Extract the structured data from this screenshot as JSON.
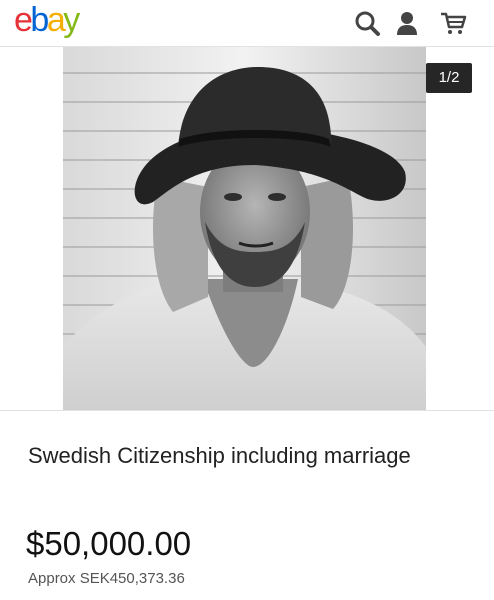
{
  "header": {
    "logo": {
      "letters": [
        "e",
        "b",
        "a",
        "y"
      ],
      "colors": [
        "#e53238",
        "#0064d2",
        "#f5af02",
        "#86b817"
      ]
    },
    "icons": [
      "search-icon",
      "user-icon",
      "cart-icon"
    ]
  },
  "gallery": {
    "counter": "1/2",
    "image": "black-and-white-portrait-man-with-wide-brim-hat"
  },
  "listing": {
    "title": "Swedish Citizenship including marriage",
    "price": "$50,000.00",
    "approx_price": "Approx SEK450,373.36"
  }
}
